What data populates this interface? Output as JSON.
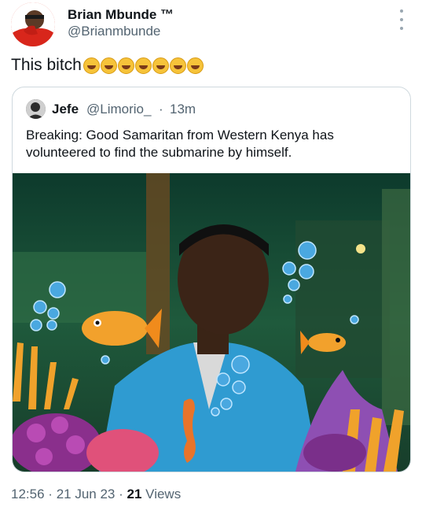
{
  "author": {
    "name": "Brian Mbunde ™",
    "handle": "@Brianmbunde"
  },
  "tweet": {
    "text": "This bitch",
    "emoji_count": 7,
    "emoji_icon": "laughing-emoji-icon"
  },
  "quoted": {
    "name": "Jefe",
    "handle": "@Limorio_",
    "separator": "·",
    "time": "13m",
    "text": "Breaking: Good Samaritan from Western Kenya has volunteered to find the submarine by himself."
  },
  "meta": {
    "time": "12:56",
    "sep1": "·",
    "date": "21 Jun 23",
    "sep2": "·",
    "views_count": "21",
    "views_label": "Views"
  },
  "colors": {
    "text": "#0f1419",
    "muted": "#536471",
    "border": "#cfd9de",
    "fish": "#f2a12c",
    "bubble": "#4aa8e0"
  }
}
